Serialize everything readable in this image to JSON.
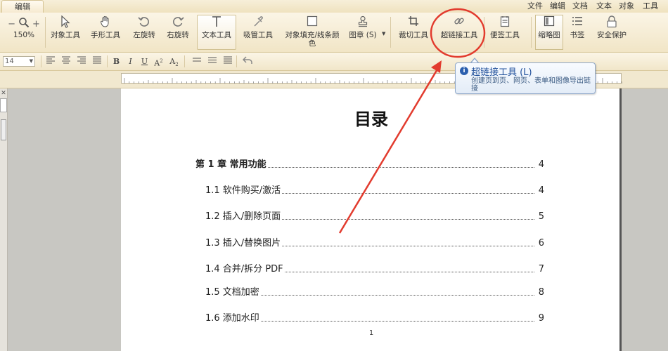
{
  "app": {
    "active_tab": "编辑",
    "menu": [
      "文件",
      "编辑",
      "文档",
      "文本",
      "对象",
      "工具"
    ]
  },
  "toolbar": {
    "zoom_minus": "−",
    "zoom_plus": "+",
    "zoom_level": "150%",
    "tools": {
      "object": "对象工具",
      "hand": "手形工具",
      "rotate_left": "左旋转",
      "rotate_right": "右旋转",
      "text": "文本工具",
      "eyedropper": "吸管工具",
      "fill_line_color_1": "对象填充/线条颜",
      "fill_line_color_2": "色",
      "stamp": "图章 (S)",
      "crop": "裁切工具",
      "hyperlink": "超链接工具",
      "sticky_note": "便签工具",
      "thumbnail": "缩略图",
      "bookmark": "书签",
      "security": "安全保护"
    }
  },
  "format_bar": {
    "font_size": "14",
    "bold": "B",
    "italic": "I",
    "underline": "U",
    "superscript": "A",
    "subscript": "A"
  },
  "tooltip": {
    "title": "超链接工具 (L)",
    "description": "创建页到页、网页、表单和图像导出链接"
  },
  "document": {
    "title": "目录",
    "toc": [
      {
        "label": "第 1 章  常用功能",
        "page": "4",
        "bold": true
      },
      {
        "label": "1.1 软件购买/激活",
        "page": "4"
      },
      {
        "label": "1.2 插入/删除页面",
        "page": "5"
      },
      {
        "label": "1.3 插入/替换图片",
        "page": "6"
      },
      {
        "label": "1.4 合并/拆分 PDF",
        "page": "7"
      },
      {
        "label": "1.5 文档加密",
        "page": "8"
      },
      {
        "label": "1.6 添加水印",
        "page": "9"
      }
    ],
    "page_number": "1"
  },
  "colors": {
    "annotation": "#e23b2e",
    "toolbar_bg": "#f4ead0",
    "tooltip_title": "#1f4f9a"
  },
  "icons": {
    "zoom": "magnifier-icon",
    "object": "cursor-arrow-icon",
    "hand": "hand-icon",
    "rotate_left": "rotate-left-icon",
    "rotate_right": "rotate-right-icon",
    "text": "text-cursor-icon",
    "eyedropper": "eyedropper-icon",
    "fill": "square-fill-icon",
    "stamp": "stamp-icon",
    "crop": "crop-icon",
    "hyperlink": "chain-link-icon",
    "sticky_note": "note-icon",
    "thumbnail": "thumbnail-icon",
    "bookmark": "bookmark-list-icon",
    "security": "lock-icon",
    "info": "info-icon"
  }
}
